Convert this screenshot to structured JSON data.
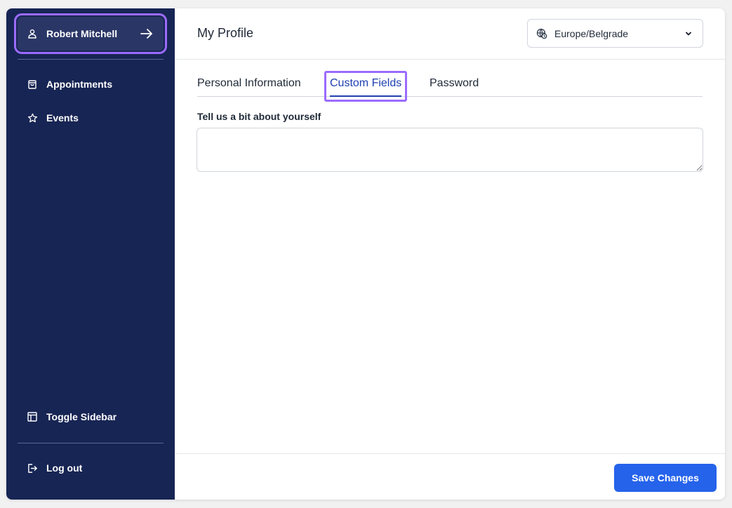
{
  "sidebar": {
    "user_name": "Robert Mitchell",
    "items": [
      {
        "label": "Appointments",
        "icon": "shopping-bag-icon"
      },
      {
        "label": "Events",
        "icon": "star-icon"
      }
    ],
    "toggle_label": "Toggle Sidebar",
    "logout_label": "Log out"
  },
  "header": {
    "title": "My Profile",
    "timezone": "Europe/Belgrade"
  },
  "tabs": [
    {
      "label": "Personal Information",
      "active": false
    },
    {
      "label": "Custom Fields",
      "active": true
    },
    {
      "label": "Password",
      "active": false
    }
  ],
  "form": {
    "about_label": "Tell us a bit about yourself",
    "about_value": ""
  },
  "footer": {
    "save_label": "Save Changes"
  },
  "colors": {
    "sidebar_bg": "#172554",
    "accent": "#2563eb",
    "active_tab": "#1e40af",
    "highlight": "#9b6bff"
  }
}
